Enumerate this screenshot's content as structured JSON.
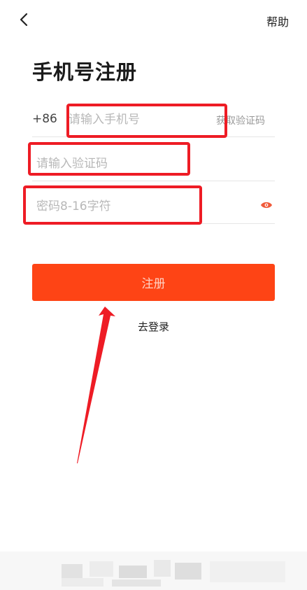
{
  "header": {
    "back_icon": "chevron-left-icon",
    "help_label": "帮助"
  },
  "title": "手机号注册",
  "phone": {
    "country_code": "+86",
    "placeholder": "请输入手机号",
    "get_code_label": "获取验证码"
  },
  "code": {
    "placeholder": "请输入验证码"
  },
  "password": {
    "placeholder": "密码8-16字符",
    "eye_icon": "eye-icon"
  },
  "register_label": "注册",
  "login_label": "去登录",
  "colors": {
    "accent": "#fe4415",
    "annotation": "#ee1c25"
  }
}
